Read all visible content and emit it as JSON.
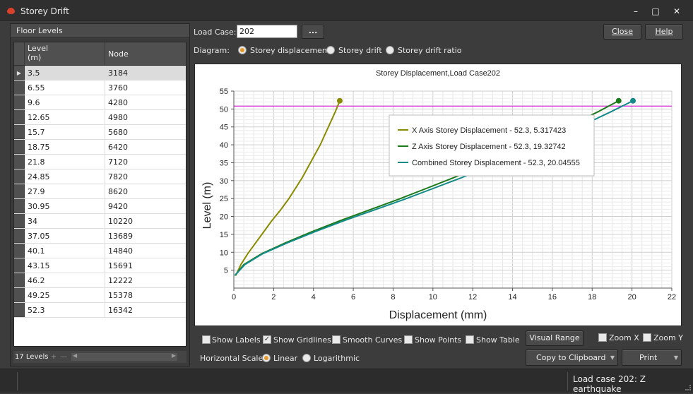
{
  "window": {
    "title": "Storey Drift"
  },
  "floor_levels": {
    "header": "Floor Levels",
    "col_level": "Level\n(m)",
    "col_node": "Node",
    "rows": [
      {
        "level": "3.5",
        "node": "3184"
      },
      {
        "level": "6.55",
        "node": "3760"
      },
      {
        "level": "9.6",
        "node": "4280"
      },
      {
        "level": "12.65",
        "node": "4980"
      },
      {
        "level": "15.7",
        "node": "5680"
      },
      {
        "level": "18.75",
        "node": "6420"
      },
      {
        "level": "21.8",
        "node": "7120"
      },
      {
        "level": "24.85",
        "node": "7820"
      },
      {
        "level": "27.9",
        "node": "8620"
      },
      {
        "level": "30.95",
        "node": "9420"
      },
      {
        "level": "34",
        "node": "10220"
      },
      {
        "level": "37.05",
        "node": "13689"
      },
      {
        "level": "40.1",
        "node": "14840"
      },
      {
        "level": "43.15",
        "node": "15691"
      },
      {
        "level": "46.2",
        "node": "12222"
      },
      {
        "level": "49.25",
        "node": "15378"
      },
      {
        "level": "52.3",
        "node": "16342"
      }
    ],
    "footer_count": "17 Levels"
  },
  "controls": {
    "load_case_label": "Load Case:",
    "load_case_value": "202",
    "browse_label": "...",
    "close_label": "Close",
    "help_label": "Help",
    "diagram_label": "Diagram:",
    "diagram_options": [
      "Storey displacement",
      "Storey drift",
      "Storey drift ratio"
    ],
    "diagram_selected": "Storey displacement"
  },
  "options": {
    "show_labels": {
      "label": "Show Labels",
      "checked": false
    },
    "show_gridlines": {
      "label": "Show Gridlines",
      "checked": true
    },
    "smooth_curves": {
      "label": "Smooth Curves",
      "checked": false
    },
    "show_points": {
      "label": "Show Points",
      "checked": false
    },
    "show_table": {
      "label": "Show Table",
      "checked": false
    },
    "visual_range_label": "Visual Range",
    "zoom_x": {
      "label": "Zoom X",
      "checked": false
    },
    "zoom_y": {
      "label": "Zoom Y",
      "checked": false
    },
    "horizontal_scale_label": "Horizontal Scale:",
    "scale_options": [
      "Linear",
      "Logarithmic"
    ],
    "scale_selected": "Linear",
    "copy_label": "Copy to Clipboard",
    "print_label": "Print"
  },
  "status": {
    "text": "Load case 202: Z earthquake"
  },
  "colors": {
    "x_series": "#8a8a00",
    "z_series": "#1a7a1a",
    "combined_series": "#138a8a",
    "reference_line": "#d400d4"
  },
  "chart_data": {
    "type": "line",
    "title": "Storey Displacement,Load Case202",
    "xlabel": "Displacement (mm)",
    "ylabel": "Level (m)",
    "xlim": [
      0,
      22
    ],
    "ylim": [
      0,
      55
    ],
    "xticks": [
      0,
      2,
      4,
      6,
      8,
      10,
      12,
      14,
      16,
      18,
      20,
      22
    ],
    "yticks": [
      5,
      10,
      15,
      20,
      25,
      30,
      35,
      40,
      45,
      50,
      55
    ],
    "grid": true,
    "reference_level": 50.8,
    "legend": {
      "placement": "top-right",
      "entries": [
        "X Axis Storey Displacement - 52.3, 5.317423",
        "Z Axis Storey Displacement - 52.3, 19.32742",
        "Combined Storey Displacement - 52.3, 20.04555"
      ]
    },
    "series": [
      {
        "name": "X Axis Storey Displacement",
        "points": [
          [
            0.1,
            3.5
          ],
          [
            0.35,
            6.55
          ],
          [
            0.7,
            9.6
          ],
          [
            1.1,
            12.65
          ],
          [
            1.5,
            15.7
          ],
          [
            1.9,
            18.75
          ],
          [
            2.35,
            21.8
          ],
          [
            2.75,
            24.85
          ],
          [
            3.1,
            27.9
          ],
          [
            3.45,
            30.95
          ],
          [
            3.75,
            34
          ],
          [
            4.05,
            37.05
          ],
          [
            4.35,
            40.1
          ],
          [
            4.6,
            43.15
          ],
          [
            4.85,
            46.2
          ],
          [
            5.1,
            49.25
          ],
          [
            5.32,
            52.3
          ]
        ]
      },
      {
        "name": "Z Axis Storey Displacement",
        "points": [
          [
            0.05,
            3.5
          ],
          [
            0.5,
            6.55
          ],
          [
            1.4,
            9.6
          ],
          [
            2.6,
            12.65
          ],
          [
            3.9,
            15.7
          ],
          [
            5.3,
            18.75
          ],
          [
            6.8,
            21.8
          ],
          [
            8.3,
            24.85
          ],
          [
            9.7,
            27.9
          ],
          [
            11.1,
            30.95
          ],
          [
            12.4,
            34
          ],
          [
            13.6,
            37.05
          ],
          [
            14.8,
            40.1
          ],
          [
            16.0,
            43.15
          ],
          [
            17.2,
            46.2
          ],
          [
            18.3,
            49.25
          ],
          [
            19.33,
            52.3
          ]
        ]
      },
      {
        "name": "Combined Storey Displacement",
        "points": [
          [
            0.05,
            3.5
          ],
          [
            0.55,
            6.55
          ],
          [
            1.45,
            9.6
          ],
          [
            2.7,
            12.65
          ],
          [
            4.05,
            15.7
          ],
          [
            5.5,
            18.75
          ],
          [
            7.05,
            21.8
          ],
          [
            8.6,
            24.85
          ],
          [
            10.05,
            27.9
          ],
          [
            11.5,
            30.95
          ],
          [
            12.85,
            34
          ],
          [
            14.1,
            37.05
          ],
          [
            15.35,
            40.1
          ],
          [
            16.6,
            43.15
          ],
          [
            17.8,
            46.2
          ],
          [
            18.95,
            49.25
          ],
          [
            20.05,
            52.3
          ]
        ]
      }
    ]
  }
}
